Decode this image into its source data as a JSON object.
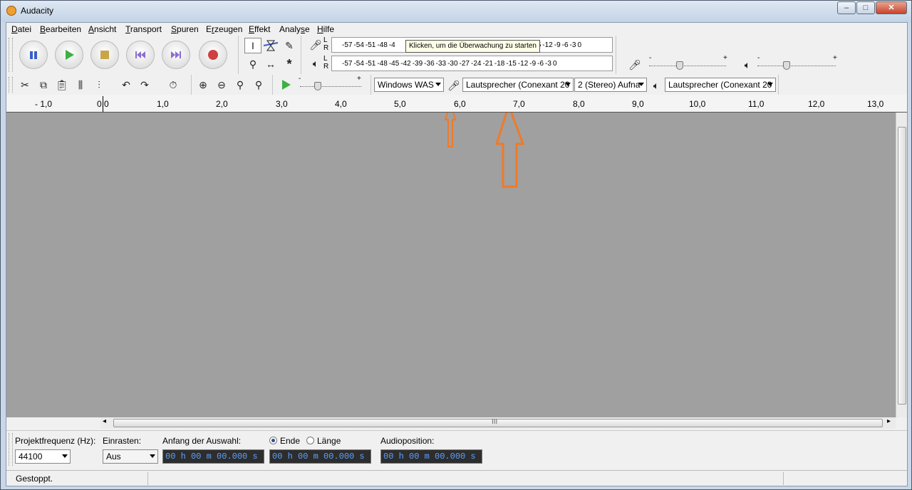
{
  "window": {
    "title": "Audacity",
    "min": "–",
    "max": "□",
    "close": "✕"
  },
  "menu": [
    {
      "pre": "",
      "key": "D",
      "rest": "atei"
    },
    {
      "pre": "",
      "key": "B",
      "rest": "earbeiten"
    },
    {
      "pre": "",
      "key": "A",
      "rest": "nsicht"
    },
    {
      "pre": "",
      "key": "T",
      "rest": "ransport"
    },
    {
      "pre": "",
      "key": "S",
      "rest": "puren"
    },
    {
      "pre": "E",
      "key": "r",
      "rest": "zeugen"
    },
    {
      "pre": "",
      "key": "E",
      "rest": "ffekt"
    },
    {
      "pre": "Analy",
      "key": "s",
      "rest": "e"
    },
    {
      "pre": "",
      "key": "H",
      "rest": "ilfe"
    }
  ],
  "meters": {
    "rec_lr": [
      "L",
      "R"
    ],
    "play_lr": [
      "L",
      "R"
    ],
    "rec_scale": [
      "-57",
      "-54",
      "-51",
      "-48",
      "-4",
      "5",
      "-12",
      "-9",
      "-6",
      "-3",
      "0"
    ],
    "play_scale": [
      "-57",
      "-54",
      "-51",
      "-48",
      "-45",
      "-42",
      "-39",
      "-36",
      "-33",
      "-30",
      "-27",
      "-24",
      "-21",
      "-18",
      "-15",
      "-12",
      "-9",
      "-6",
      "-3",
      "0"
    ],
    "tooltip": "Klicken, um die Überwachung zu starten"
  },
  "sliders": {
    "minus": "-",
    "plus": "+"
  },
  "devices": {
    "host": "Windows WAS",
    "recording_device": "Lautsprecher (Conexant 20",
    "channels": "2 (Stereo) Aufna",
    "playback_device": "Lautsprecher (Conexant 20"
  },
  "ruler": {
    "labels": [
      "- 1,0",
      "0,0",
      "1,0",
      "2,0",
      "3,0",
      "4,0",
      "5,0",
      "6,0",
      "7,0",
      "8,0",
      "9,0",
      "10,0",
      "11,0",
      "12,0",
      "13,0"
    ]
  },
  "selection": {
    "rate_label": "Projektfrequenz (Hz):",
    "rate_value": "44100",
    "snap_label": "Einrasten:",
    "snap_value": "Aus",
    "start_label": "Anfang der Auswahl:",
    "end_label": "Ende",
    "length_label": "Länge",
    "audio_pos_label": "Audioposition:",
    "time_value": "00 h 00 m 00.000 s"
  },
  "status": {
    "text": "Gestoppt."
  },
  "colors": {
    "annotation_arrow": "#f07a28",
    "track_bg": "#a0a0a0"
  },
  "scroll": {
    "grip": "III",
    "left": "◂",
    "right": "▸"
  }
}
